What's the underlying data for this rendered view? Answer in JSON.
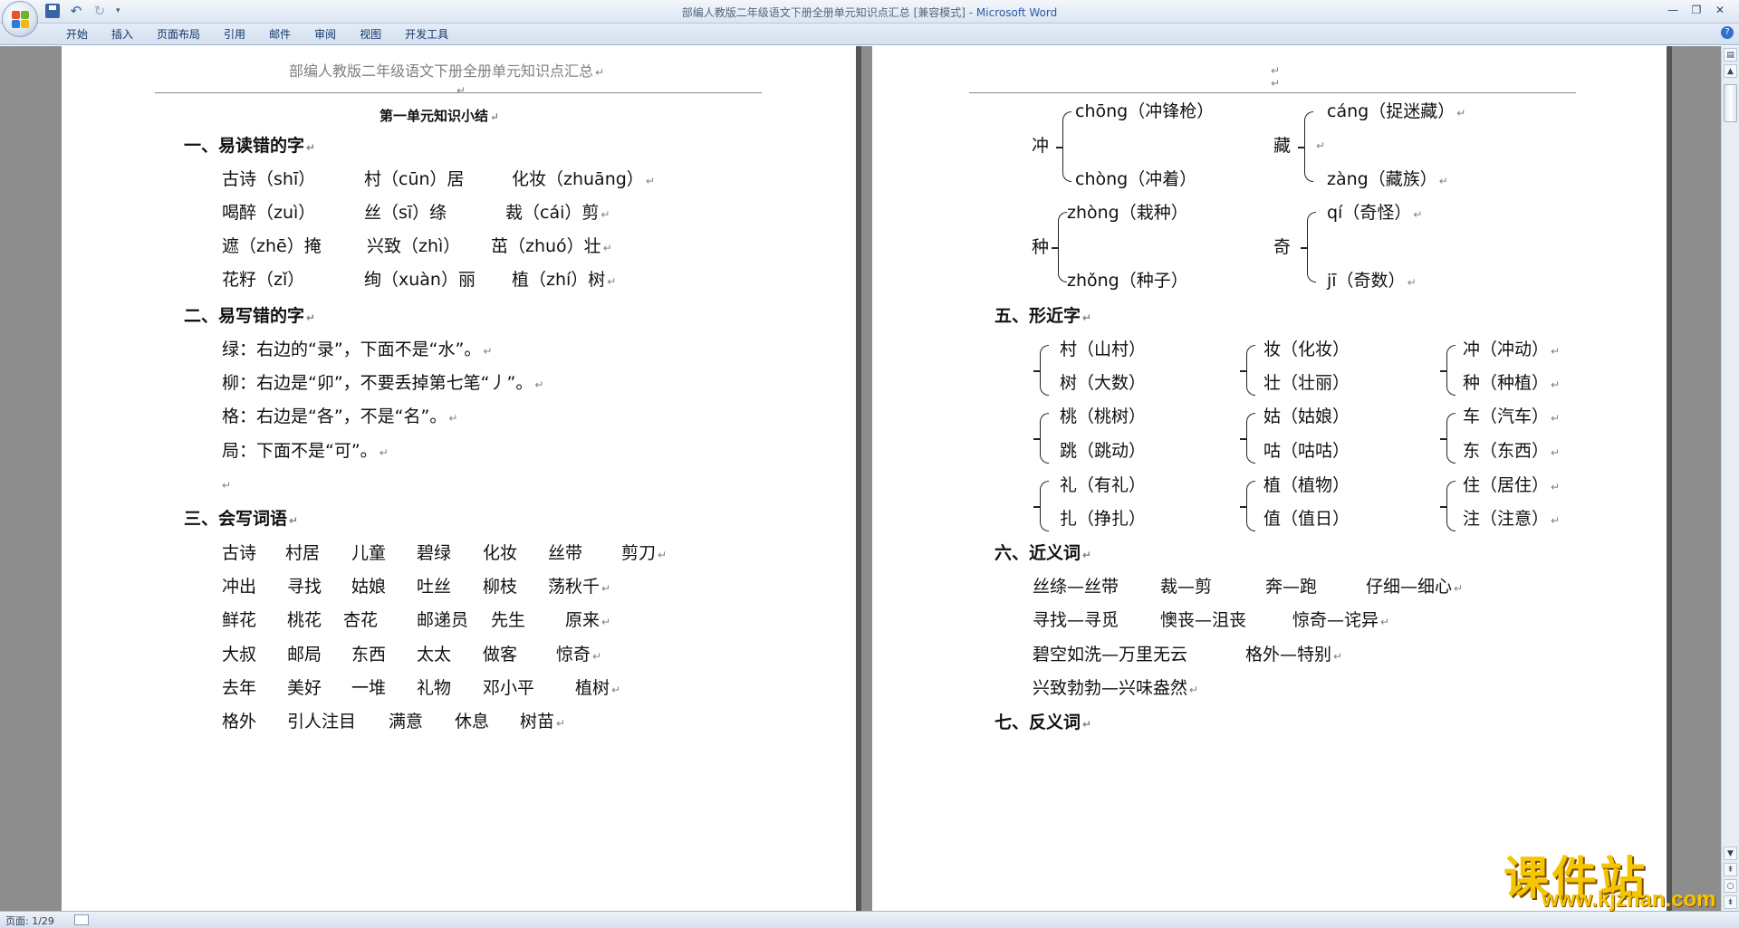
{
  "window": {
    "title": "部编人教版二年级语文下册全册单元知识点汇总 [兼容模式] - ",
    "app_name": "Microsoft Word"
  },
  "ribbon_tabs": [
    "开始",
    "插入",
    "页面布局",
    "引用",
    "邮件",
    "审阅",
    "视图",
    "开发工具"
  ],
  "status": {
    "page": "页面: 1/29"
  },
  "left_page": {
    "header": "部编人教版二年级语文下册全册单元知识点汇总",
    "title": "第一单元知识小结",
    "sec1": {
      "heading": "一、易读错的字",
      "rows": [
        [
          "古诗（shī）",
          "村（cūn）居",
          "化妆（zhuāng）"
        ],
        [
          "喝醉（zuì）",
          "丝（sī）绦",
          "裁（cái）剪"
        ],
        [
          "遮（zhē）掩",
          "兴致（zhì）",
          "茁（zhuó）壮"
        ],
        [
          "花籽（zǐ）",
          "绚（xuàn）丽",
          "植（zhí）树"
        ]
      ]
    },
    "sec2": {
      "heading": "二、易写错的字",
      "lines": [
        "绿：右边的“录”，下面不是“水”。",
        "柳：右边是“卯”，不要丢掉第七笔“丿”。",
        "格：右边是“各”，不是“名”。",
        "局：下面不是“可”。"
      ]
    },
    "sec3": {
      "heading": "三、会写词语",
      "rows": [
        [
          "古诗",
          "村居",
          "儿童",
          "碧绿",
          "化妆",
          "丝带",
          "剪刀"
        ],
        [
          "冲出",
          "寻找",
          "姑娘",
          "吐丝",
          "柳枝",
          "荡秋千"
        ],
        [
          "鲜花",
          "桃花",
          "杏花",
          "邮递员",
          "先生",
          "原来"
        ],
        [
          "大叔",
          "邮局",
          "东西",
          "太太",
          "做客",
          "惊奇"
        ],
        [
          "去年",
          "美好",
          "一堆",
          "礼物",
          "邓小平",
          "植树"
        ],
        [
          "格外",
          "引人注目",
          "满意",
          "休息",
          "树苗"
        ]
      ]
    }
  },
  "right_page": {
    "sec4": {
      "groups": [
        {
          "char": "冲",
          "top": "chōng（冲锋枪）",
          "bottom": "chòng（冲着）"
        },
        {
          "char": "藏",
          "top": "cáng（捉迷藏）",
          "bottom": "zàng（藏族）"
        },
        {
          "char": "种",
          "top": "zhòng（栽种）",
          "bottom": "zhǒng（种子）"
        },
        {
          "char": "奇",
          "top": "qí（奇怪）",
          "bottom": "jī（奇数）"
        }
      ]
    },
    "sec5": {
      "heading": "五、形近字",
      "pairs": [
        [
          "村（山村）",
          "树（大数）"
        ],
        [
          "妆（化妆）",
          "壮（壮丽）"
        ],
        [
          "冲（冲动）",
          "种（种植）"
        ],
        [
          "桃（桃树）",
          "跳（跳动）"
        ],
        [
          "姑（姑娘）",
          "咕（咕咕）"
        ],
        [
          "车（汽车）",
          "东（东西）"
        ],
        [
          "礼（有礼）",
          "扎（挣扎）"
        ],
        [
          "植（植物）",
          "值（值日）"
        ],
        [
          "住（居住）",
          "注（注意）"
        ]
      ]
    },
    "sec6": {
      "heading": "六、近义词",
      "rows": [
        [
          "丝绦—丝带",
          "裁—剪",
          "奔—跑",
          "仔细—细心"
        ],
        [
          "寻找—寻觅",
          "懊丧—沮丧",
          "惊奇—诧异"
        ],
        [
          "碧空如洗—万里无云",
          "格外—特别"
        ],
        [
          "兴致勃勃—兴味盎然"
        ]
      ]
    },
    "sec7": {
      "heading": "七、反义词"
    }
  },
  "watermark": {
    "text": "课件站",
    "url": "www.kjzhan.com"
  }
}
